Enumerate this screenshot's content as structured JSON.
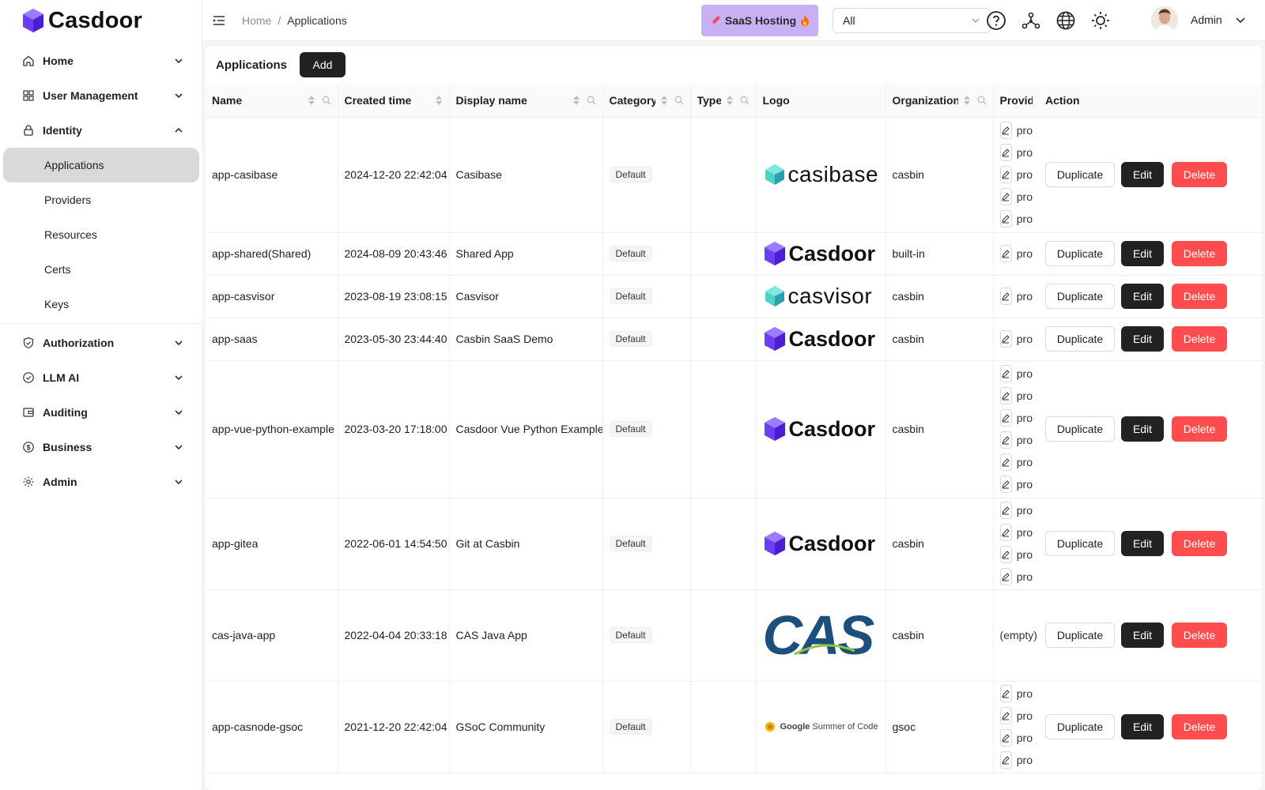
{
  "brand": {
    "name": "Casdoor",
    "accent": "#6d3df5"
  },
  "sidebar": {
    "items": [
      {
        "label": "Home",
        "icon": "home-icon",
        "expanded": false
      },
      {
        "label": "User Management",
        "icon": "grid-icon",
        "expanded": false
      },
      {
        "label": "Identity",
        "icon": "lock-icon",
        "expanded": true,
        "children": [
          "Applications",
          "Providers",
          "Resources",
          "Certs",
          "Keys"
        ],
        "active": "Applications"
      },
      {
        "label": "Authorization",
        "icon": "shield-check-icon",
        "expanded": false
      },
      {
        "label": "LLM AI",
        "icon": "check-circle-icon",
        "expanded": false
      },
      {
        "label": "Auditing",
        "icon": "wallet-icon",
        "expanded": false
      },
      {
        "label": "Business",
        "icon": "dollar-icon",
        "expanded": false
      },
      {
        "label": "Admin",
        "icon": "gear-icon",
        "expanded": false
      }
    ]
  },
  "header": {
    "breadcrumb": {
      "home": "Home",
      "sep": "/",
      "current": "Applications"
    },
    "saas_label": "SaaS Hosting",
    "org_select": {
      "value": "All"
    },
    "user_name": "Admin"
  },
  "page": {
    "title": "Applications",
    "add_label": "Add"
  },
  "table": {
    "columns": [
      "Name",
      "Created time",
      "Display name",
      "Category",
      "Type",
      "Logo",
      "Organization",
      "Provider",
      "Action"
    ],
    "rows": [
      {
        "name": "app-casibase",
        "created": "2024-12-20 22:42:04",
        "display": "Casibase",
        "category": "Default",
        "logo": "casibase",
        "org": "casbin",
        "providers": [
          "pro",
          "pro",
          "pro",
          "pro",
          "pro"
        ]
      },
      {
        "name": "app-shared(Shared)",
        "created": "2024-08-09 20:43:46",
        "display": "Shared App",
        "category": "Default",
        "logo": "casdoor",
        "org": "built-in",
        "providers": [
          "pro"
        ]
      },
      {
        "name": "app-casvisor",
        "created": "2023-08-19 23:08:15",
        "display": "Casvisor",
        "category": "Default",
        "logo": "casvisor",
        "org": "casbin",
        "providers": [
          "pro"
        ]
      },
      {
        "name": "app-saas",
        "created": "2023-05-30 23:44:40",
        "display": "Casbin SaaS Demo",
        "category": "Default",
        "logo": "casdoor",
        "org": "casbin",
        "providers": [
          "pro"
        ]
      },
      {
        "name": "app-vue-python-example",
        "created": "2023-03-20 17:18:00",
        "display": "Casdoor Vue Python Example",
        "category": "Default",
        "logo": "casdoor",
        "org": "casbin",
        "providers": [
          "pro",
          "pro",
          "pro",
          "pro",
          "pro",
          "pro"
        ]
      },
      {
        "name": "app-gitea",
        "created": "2022-06-01 14:54:50",
        "display": "Git at Casbin",
        "category": "Default",
        "logo": "casdoor",
        "org": "casbin",
        "providers": [
          "pro",
          "pro",
          "pro",
          "pro"
        ]
      },
      {
        "name": "cas-java-app",
        "created": "2022-04-04 20:33:18",
        "display": "CAS Java App",
        "category": "Default",
        "logo": "cas",
        "org": "casbin",
        "providers": [],
        "providers_empty": "(empty)"
      },
      {
        "name": "app-casnode-gsoc",
        "created": "2021-12-20 22:42:04",
        "display": "GSoC Community",
        "category": "Default",
        "logo": "gsoc",
        "org": "gsoc",
        "providers": [
          "pro",
          "pro",
          "pro",
          "pro"
        ]
      }
    ],
    "actions": {
      "duplicate": "Duplicate",
      "edit": "Edit",
      "delete": "Delete"
    }
  },
  "logo_text": {
    "casibase": "casibase",
    "casdoor": "Casdoor",
    "casvisor": "casvisor",
    "cas": "CAS",
    "gsoc_google": "Google",
    "gsoc_rest": "Summer of Code"
  }
}
